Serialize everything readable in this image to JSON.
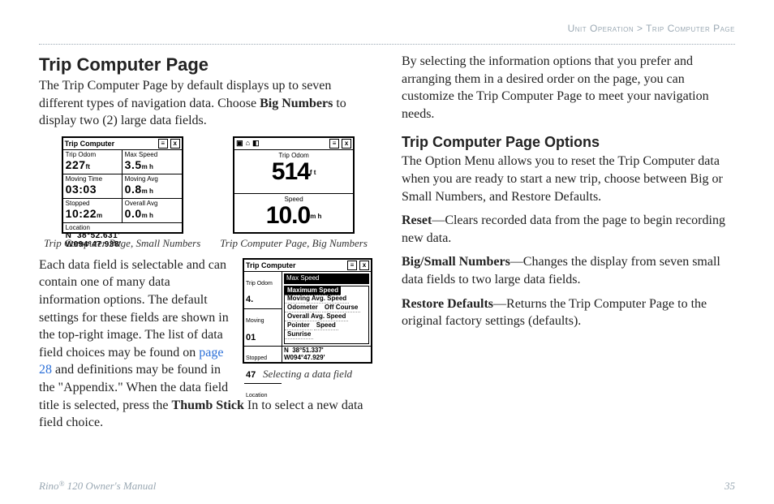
{
  "breadcrumb": {
    "section": "Unit Operation",
    "sep": " > ",
    "page": "Trip Computer Page"
  },
  "left": {
    "heading": "Trip Computer Page",
    "intro_a": "The Trip Computer Page by default displays up to seven different types of navigation data. Choose ",
    "intro_bold": "Big Numbers",
    "intro_b": " to display two (2) large data fields.",
    "para2_a": "Each data field is selectable and can contain one of many data information options. The default settings for these fields are shown in the top-right image. The list of data field choices may be found on ",
    "link": "page 28",
    "para2_b": " and definitions may be found in the \"Appendix.\" When the data field title is selected, press the ",
    "para2_bold": "Thumb Stick",
    "para2_c": " In to select a new data field choice."
  },
  "right": {
    "intro": "By selecting the information options that you prefer and arranging them in a desired order on the page, you can customize the Trip Computer Page to meet your navigation needs.",
    "subhead": "Trip Computer Page Options",
    "options_intro": "The Option Menu allows you to reset the Trip Computer data when you are ready to start a new trip, choose between Big or Small Numbers, and Restore Defaults.",
    "reset_label": "Reset",
    "reset_text": "—Clears recorded data from the page to begin recording new data.",
    "bigsmall_label": "Big/Small Numbers",
    "bigsmall_text": "—Changes the display from seven small data fields to two large data fields.",
    "restore_label": "Restore Defaults",
    "restore_text": "—Returns the Trip Computer Page to the original factory settings (defaults)."
  },
  "captions": {
    "small": "Trip Computer Page, Small Numbers",
    "big": "Trip Computer Page, Big Numbers",
    "selecting": "Selecting a data field"
  },
  "device_small": {
    "title": "Trip Computer",
    "fields": [
      {
        "label": "Trip Odom",
        "value": "227",
        "unit": "ft"
      },
      {
        "label": "Max Speed",
        "value": "3.5",
        "unit": "m h"
      },
      {
        "label": "Moving Time",
        "value": "03:03",
        "unit": ""
      },
      {
        "label": "Moving Avg",
        "value": "0.8",
        "unit": "m h"
      },
      {
        "label": "Stopped",
        "value": "10:22",
        "unit": "m"
      },
      {
        "label": "Overall Avg",
        "value": "0.0",
        "unit": "m h"
      }
    ],
    "location_label": "Location",
    "location_value": "N  38°52.631'\nW094°47.938'"
  },
  "device_big": {
    "title_icons": [
      "▣",
      "⌂",
      "◧"
    ],
    "fields": [
      {
        "label": "Trip Odom",
        "value": "514",
        "unit": "f t"
      },
      {
        "label": "Speed",
        "value": "10.0",
        "unit": "m h"
      }
    ]
  },
  "device_sel": {
    "title": "Trip Computer",
    "left_cells": [
      {
        "label": "Trip Odom",
        "value": "4."
      },
      {
        "label": "Moving",
        "value": "01"
      },
      {
        "label": "Stopped",
        "value": "47"
      },
      {
        "label": "Location",
        "value": ""
      }
    ],
    "highlight": "Max Speed",
    "menu": [
      "Maximum Speed",
      "Moving Avg. Speed",
      "Odometer",
      "Off Course",
      "Overall Avg. Speed",
      "Pointer",
      "Speed",
      "Sunrise"
    ],
    "location_value": "N  38°51.337'\nW094°47.929'"
  },
  "footer": {
    "manual": "Rino",
    "reg": "®",
    "manual2": " 120 Owner's Manual",
    "page": "35"
  }
}
